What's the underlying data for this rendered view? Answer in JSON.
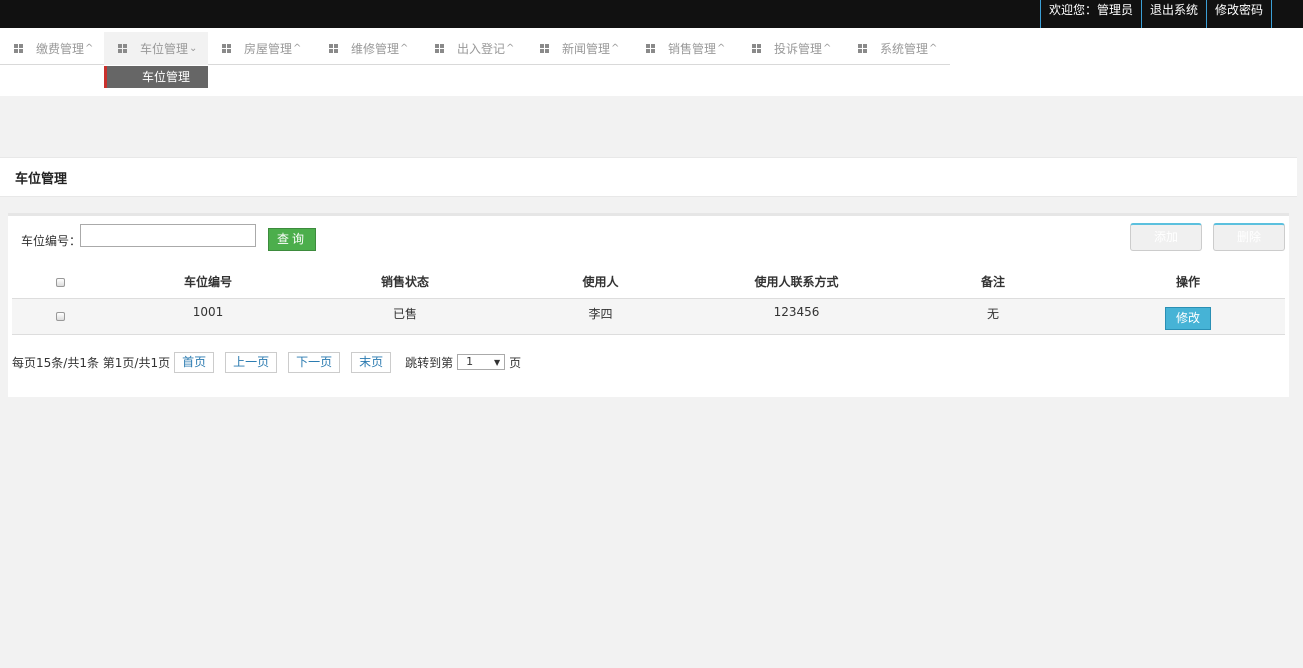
{
  "topbar": {
    "welcome": "欢迎您：管理员",
    "logout": "退出系统",
    "change_password": "修改密码"
  },
  "nav": {
    "items": [
      {
        "label": "缴费管理",
        "chevron": "^"
      },
      {
        "label": "车位管理",
        "chevron": "v"
      },
      {
        "label": "房屋管理",
        "chevron": "^"
      },
      {
        "label": "维修管理",
        "chevron": "^"
      },
      {
        "label": "出入登记",
        "chevron": "^"
      },
      {
        "label": "新闻管理",
        "chevron": "^"
      },
      {
        "label": "销售管理",
        "chevron": "^"
      },
      {
        "label": "投诉管理",
        "chevron": "^"
      },
      {
        "label": "系统管理",
        "chevron": "^"
      }
    ],
    "active_index": 1,
    "submenu_item": "车位管理"
  },
  "page_title": "车位管理",
  "search": {
    "label": "车位编号：",
    "value": "",
    "query_button": "查询",
    "add_button": "添加",
    "delete_button": "删除"
  },
  "table": {
    "headers": [
      "车位编号",
      "销售状态",
      "使用人",
      "使用人联系方式",
      "备注",
      "操作"
    ],
    "rows": [
      {
        "id": "1001",
        "status": "已售",
        "user": "李四",
        "contact": "123456",
        "note": "无",
        "action": "修改"
      }
    ]
  },
  "pager": {
    "summary": "每页15条/共1条 第1页/共1页",
    "first": "首页",
    "prev": "上一页",
    "next": "下一页",
    "last": "末页",
    "jump_label": "跳转到第",
    "page_value": "1",
    "page_suffix": "页"
  },
  "colors": {
    "topbar_bg": "#111111",
    "accent_blue": "#3b9fd6",
    "query_green": "#4cae4c",
    "edit_blue": "#46b3d6",
    "submenu_bg": "#666666",
    "submenu_marker": "#c9302c"
  }
}
